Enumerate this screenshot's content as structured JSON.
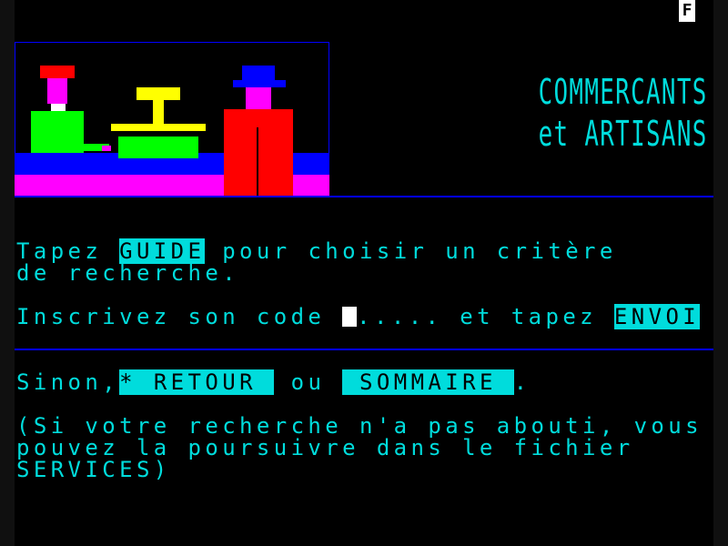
{
  "status": {
    "indicator": "F"
  },
  "title": {
    "line1": "COMMERCANTS",
    "line2": "et ARTISANS"
  },
  "colors": {
    "cyan": "#00dcdc",
    "blue": "#0000ff",
    "green": "#00ff00",
    "magenta": "#ff00ff",
    "red": "#ff0000",
    "yellow": "#ffff00",
    "white": "#ffffff",
    "black": "#000000"
  },
  "instructions": {
    "l1_pre": "Tapez ",
    "guide_key": "GUIDE",
    "l1_post": " pour choisir un critère",
    "l2": "de recherche.",
    "l3_pre": "Inscrivez son code ",
    "code_dots": ".....",
    "l3_mid": " et tapez ",
    "envoi_key": "ENVOI"
  },
  "alternatives": {
    "pre": "Sinon,",
    "star": "*",
    "retour_key": " RETOUR ",
    "mid": " ou ",
    "sommaire_key": " SOMMAIRE ",
    "post": "."
  },
  "note": {
    "l1": "(Si votre recherche n'a pas abouti, vous",
    "l2": "pouvez la poursuivre dans le fichier",
    "l3": "SERVICES)"
  }
}
